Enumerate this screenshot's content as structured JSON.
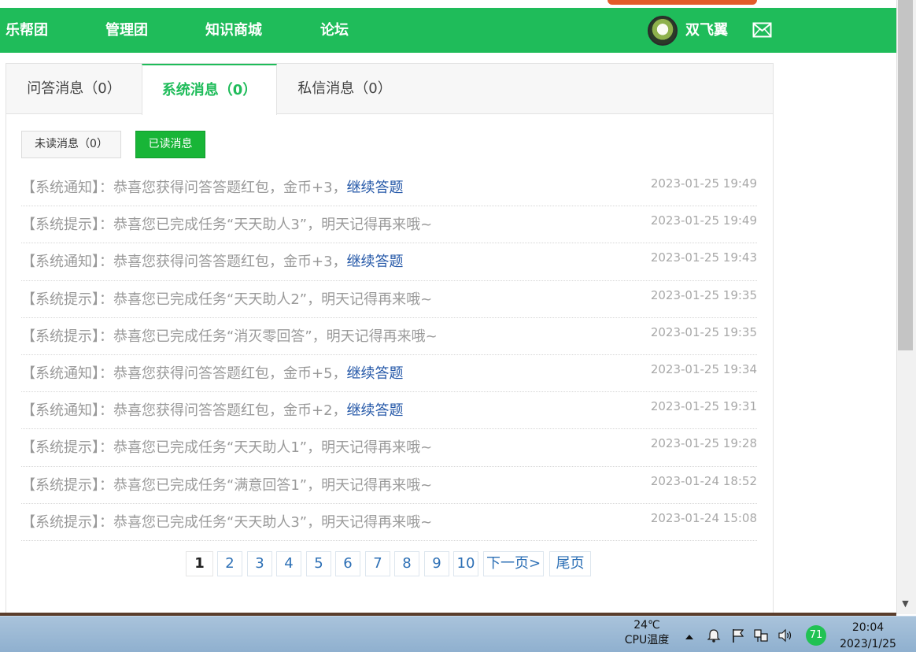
{
  "nav": {
    "items": [
      {
        "label": "乐帮团"
      },
      {
        "label": "管理团"
      },
      {
        "label": "知识商城"
      },
      {
        "label": "论坛"
      }
    ],
    "username": "双飞翼",
    "colors": {
      "nav_bg": "#1fbc5a",
      "accent": "#1fbc5a",
      "link": "#2558a8"
    }
  },
  "tabs": [
    {
      "label": "问答消息（0）",
      "active": false
    },
    {
      "label": "系统消息（0）",
      "active": true
    },
    {
      "label": "私信消息（0）",
      "active": false
    }
  ],
  "filters": {
    "unread_label": "未读消息（0）",
    "read_label": "已读消息",
    "selected": "已读消息"
  },
  "messages": [
    {
      "prefix": "【系统通知】：恭喜您获得问答答题红包，金币+3，",
      "link": "继续答题",
      "time": "2023-01-25 19:49"
    },
    {
      "prefix": "【系统提示】：恭喜您已完成任务“天天助人3”，明天记得再来哦~",
      "link": "",
      "time": "2023-01-25 19:49"
    },
    {
      "prefix": "【系统通知】：恭喜您获得问答答题红包，金币+3，",
      "link": "继续答题",
      "time": "2023-01-25 19:43"
    },
    {
      "prefix": "【系统提示】：恭喜您已完成任务“天天助人2”，明天记得再来哦~",
      "link": "",
      "time": "2023-01-25 19:35"
    },
    {
      "prefix": "【系统提示】：恭喜您已完成任务“消灭零回答”，明天记得再来哦~",
      "link": "",
      "time": "2023-01-25 19:35"
    },
    {
      "prefix": "【系统通知】：恭喜您获得问答答题红包，金币+5，",
      "link": "继续答题",
      "time": "2023-01-25 19:34"
    },
    {
      "prefix": "【系统通知】：恭喜您获得问答答题红包，金币+2，",
      "link": "继续答题",
      "time": "2023-01-25 19:31"
    },
    {
      "prefix": "【系统提示】：恭喜您已完成任务“天天助人1”，明天记得再来哦~",
      "link": "",
      "time": "2023-01-25 19:28"
    },
    {
      "prefix": "【系统提示】：恭喜您已完成任务“满意回答1”，明天记得再来哦~",
      "link": "",
      "time": "2023-01-24 18:52"
    },
    {
      "prefix": "【系统提示】：恭喜您已完成任务“天天助人3”，明天记得再来哦~",
      "link": "",
      "time": "2023-01-24 15:08"
    }
  ],
  "pagination": {
    "current": "1",
    "pages": [
      "1",
      "2",
      "3",
      "4",
      "5",
      "6",
      "7",
      "8",
      "9",
      "10"
    ],
    "next_label": "下一页>",
    "last_label": "尾页"
  },
  "taskbar": {
    "cpu_temp_value": "24℃",
    "cpu_temp_label": "CPU温度",
    "badge_value": "71",
    "time": "20:04",
    "date": "2023/1/25"
  },
  "icons": [
    "mail-icon",
    "show-hidden-icons-icon",
    "bell-icon",
    "flag-icon",
    "network-icon",
    "volume-icon"
  ]
}
